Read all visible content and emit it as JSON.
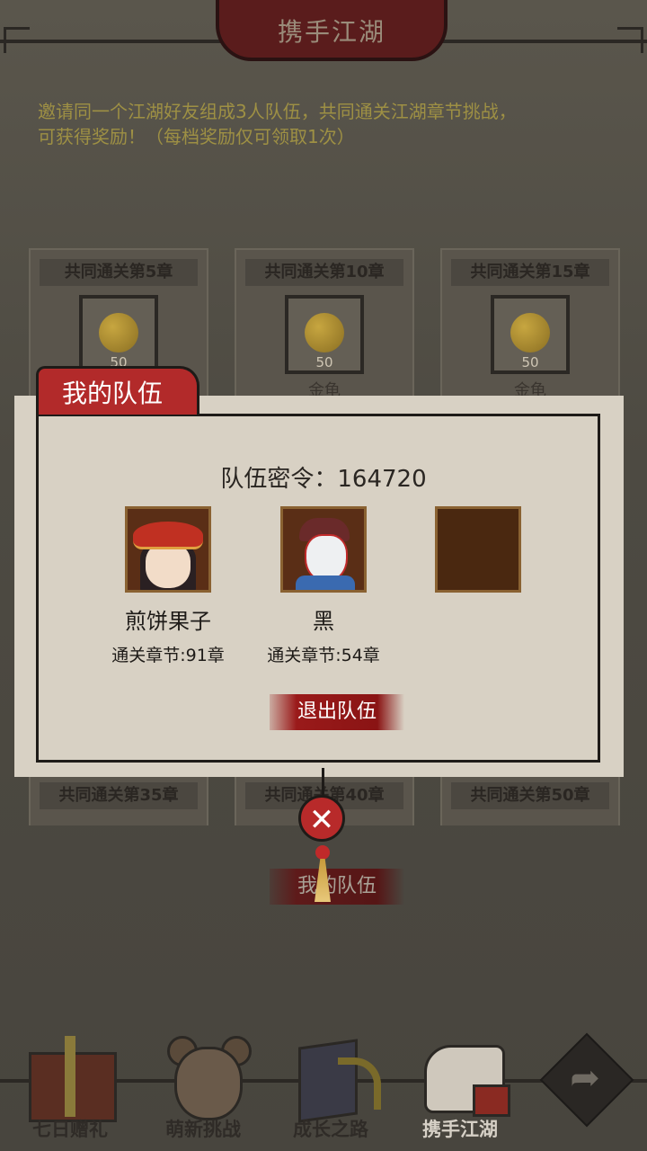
{
  "header": {
    "title": "携手江湖"
  },
  "intro": {
    "line1": "邀请同一个江湖好友组成3人队伍，共同通关江湖章节挑战，",
    "line2": "可获得奖励！（每档奖励仅可领取1次）"
  },
  "rewards_top": [
    {
      "title": "共同通关第5章",
      "count": "50",
      "name": ""
    },
    {
      "title": "共同通关第10章",
      "count": "50",
      "name": "金龟"
    },
    {
      "title": "共同通关第15章",
      "count": "50",
      "name": "金龟"
    }
  ],
  "rewards_bottom": [
    {
      "title": "共同通关第35章"
    },
    {
      "title": "共同通关第40章"
    },
    {
      "title": "共同通关第50章"
    }
  ],
  "dialog": {
    "tab_label": "我的队伍",
    "team_code_label": "队伍密令：",
    "team_code": "164720",
    "members": [
      {
        "name": "煎饼果子",
        "chapter": "通关章节:91章"
      },
      {
        "name": "黑",
        "chapter": "通关章节:54章"
      },
      {
        "name": "",
        "chapter": ""
      }
    ],
    "quit_button": "退出队伍",
    "close_symbol": "✕"
  },
  "behind_button": "我的队伍",
  "bottom_nav": [
    {
      "label": "七日赠礼",
      "icon": "gift-icon"
    },
    {
      "label": "萌新挑战",
      "icon": "girl-avatar-icon"
    },
    {
      "label": "成长之路",
      "icon": "book-icon"
    },
    {
      "label": "携手江湖",
      "icon": "handshake-icon"
    }
  ],
  "share_symbol": "➦",
  "colors": {
    "accent_red": "#b22a2a",
    "intro_text": "#9e9044",
    "dialog_bg": "#d8d1c4"
  }
}
